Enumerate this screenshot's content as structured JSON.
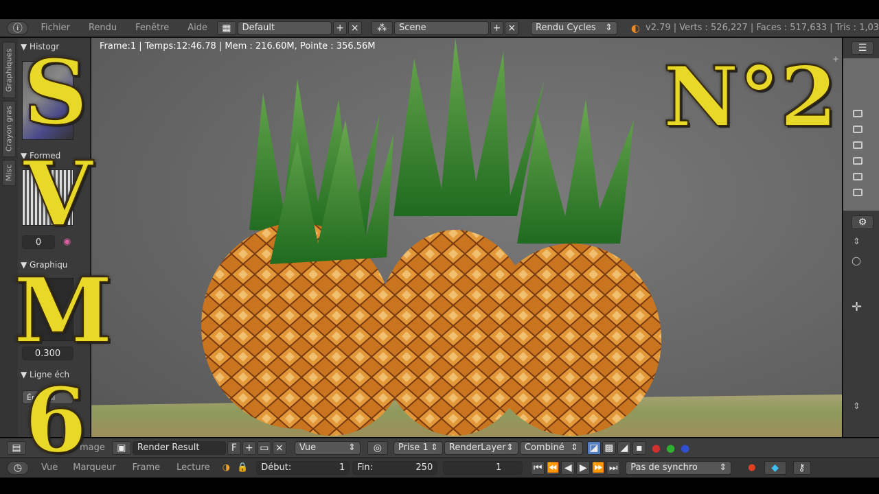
{
  "topbar": {
    "menus": [
      "Fichier",
      "Rendu",
      "Fenêtre",
      "Aide"
    ],
    "screen_layout": "Default",
    "scene": "Scene",
    "render_engine": "Rendu Cycles",
    "stats": "v2.79 | Verts : 526,227 | Faces : 517,633 | Tris : 1,03"
  },
  "viewport": {
    "render_info": "Frame:1 | Temps:12:46.78 | Mem  : 216.60M, Pointe  : 356.56M"
  },
  "left_panel": {
    "tabs": [
      "Graphiques",
      "Crayon gras",
      "Misc"
    ],
    "sections": [
      "Histogr",
      "Formed",
      "Graphiqu",
      "Ligne éch"
    ],
    "value_1": "0",
    "value_2": "0.300",
    "label_fragment": "Énuntill"
  },
  "overlay": {
    "letters": [
      "S",
      "V",
      "M",
      "6"
    ],
    "episode": "N°2"
  },
  "image_editor_header": {
    "menu_fragment": "mage",
    "image_name": "Render Result",
    "fake_user": "F",
    "view": "Vue",
    "slot": "Prise 1",
    "layer": "RenderLayer",
    "pass": "Combiné"
  },
  "timeline": {
    "menus": [
      "Vue",
      "Marqueur",
      "Frame",
      "Lecture"
    ],
    "start_label": "Début:",
    "start_value": "1",
    "end_label": "Fin:",
    "end_value": "250",
    "current_frame": "1",
    "sync": "Pas de synchro"
  },
  "icons": [
    "info-icon",
    "layout-icon",
    "scene-icon",
    "blender-logo-icon",
    "camera-icon",
    "image-icon",
    "clock-icon",
    "lock-icon",
    "record-icon",
    "keyframe-icon",
    "play-icon",
    "rewind-icon",
    "forward-icon",
    "jump-start-icon",
    "jump-end-icon"
  ],
  "colors": {
    "accent": "#e8d828",
    "panel": "#3d3d3d",
    "viewport": "#666666",
    "highlight_blue": "#5680c2"
  }
}
